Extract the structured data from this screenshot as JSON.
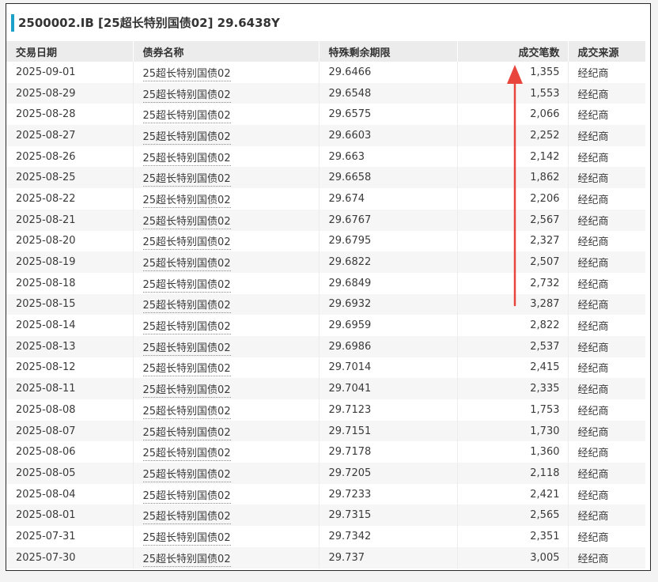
{
  "title": "2500002.IB [25超长特别国债02]  29.6438Y",
  "columns": [
    "交易日期",
    "债券名称",
    "特殊剩余期限",
    "成交笔数",
    "成交来源"
  ],
  "rows": [
    {
      "date": "2025-09-01",
      "name": "25超长特别国债02",
      "term": "29.6466",
      "count": "1,355",
      "source": "经纪商"
    },
    {
      "date": "2025-08-29",
      "name": "25超长特别国债02",
      "term": "29.6548",
      "count": "1,553",
      "source": "经纪商"
    },
    {
      "date": "2025-08-28",
      "name": "25超长特别国债02",
      "term": "29.6575",
      "count": "2,066",
      "source": "经纪商"
    },
    {
      "date": "2025-08-27",
      "name": "25超长特别国债02",
      "term": "29.6603",
      "count": "2,252",
      "source": "经纪商"
    },
    {
      "date": "2025-08-26",
      "name": "25超长特别国债02",
      "term": "29.663",
      "count": "2,142",
      "source": "经纪商"
    },
    {
      "date": "2025-08-25",
      "name": "25超长特别国债02",
      "term": "29.6658",
      "count": "1,862",
      "source": "经纪商"
    },
    {
      "date": "2025-08-22",
      "name": "25超长特别国债02",
      "term": "29.674",
      "count": "2,206",
      "source": "经纪商"
    },
    {
      "date": "2025-08-21",
      "name": "25超长特别国债02",
      "term": "29.6767",
      "count": "2,567",
      "source": "经纪商"
    },
    {
      "date": "2025-08-20",
      "name": "25超长特别国债02",
      "term": "29.6795",
      "count": "2,327",
      "source": "经纪商"
    },
    {
      "date": "2025-08-19",
      "name": "25超长特别国债02",
      "term": "29.6822",
      "count": "2,507",
      "source": "经纪商"
    },
    {
      "date": "2025-08-18",
      "name": "25超长特别国债02",
      "term": "29.6849",
      "count": "2,732",
      "source": "经纪商"
    },
    {
      "date": "2025-08-15",
      "name": "25超长特别国债02",
      "term": "29.6932",
      "count": "3,287",
      "source": "经纪商"
    },
    {
      "date": "2025-08-14",
      "name": "25超长特别国债02",
      "term": "29.6959",
      "count": "2,822",
      "source": "经纪商"
    },
    {
      "date": "2025-08-13",
      "name": "25超长特别国债02",
      "term": "29.6986",
      "count": "2,537",
      "source": "经纪商"
    },
    {
      "date": "2025-08-12",
      "name": "25超长特别国债02",
      "term": "29.7014",
      "count": "2,415",
      "source": "经纪商"
    },
    {
      "date": "2025-08-11",
      "name": "25超长特别国债02",
      "term": "29.7041",
      "count": "2,335",
      "source": "经纪商"
    },
    {
      "date": "2025-08-08",
      "name": "25超长特别国债02",
      "term": "29.7123",
      "count": "1,753",
      "source": "经纪商"
    },
    {
      "date": "2025-08-07",
      "name": "25超长特别国债02",
      "term": "29.7151",
      "count": "1,730",
      "source": "经纪商"
    },
    {
      "date": "2025-08-06",
      "name": "25超长特别国债02",
      "term": "29.7178",
      "count": "1,360",
      "source": "经纪商"
    },
    {
      "date": "2025-08-05",
      "name": "25超长特别国债02",
      "term": "29.7205",
      "count": "2,118",
      "source": "经纪商"
    },
    {
      "date": "2025-08-04",
      "name": "25超长特别国债02",
      "term": "29.7233",
      "count": "2,421",
      "source": "经纪商"
    },
    {
      "date": "2025-08-01",
      "name": "25超长特别国债02",
      "term": "29.7315",
      "count": "2,565",
      "source": "经纪商"
    },
    {
      "date": "2025-07-31",
      "name": "25超长特别国债02",
      "term": "29.7342",
      "count": "2,351",
      "source": "经纪商"
    },
    {
      "date": "2025-07-30",
      "name": "25超长特别国债02",
      "term": "29.737",
      "count": "3,005",
      "source": "经纪商"
    }
  ],
  "colors": {
    "accent": "#1aa1c7",
    "annotation_arrow": "#e8453c",
    "header_bg": "#ececec",
    "stripe_bg": "#f6f6f6"
  },
  "annotation": {
    "icon": "up-arrow-icon"
  }
}
